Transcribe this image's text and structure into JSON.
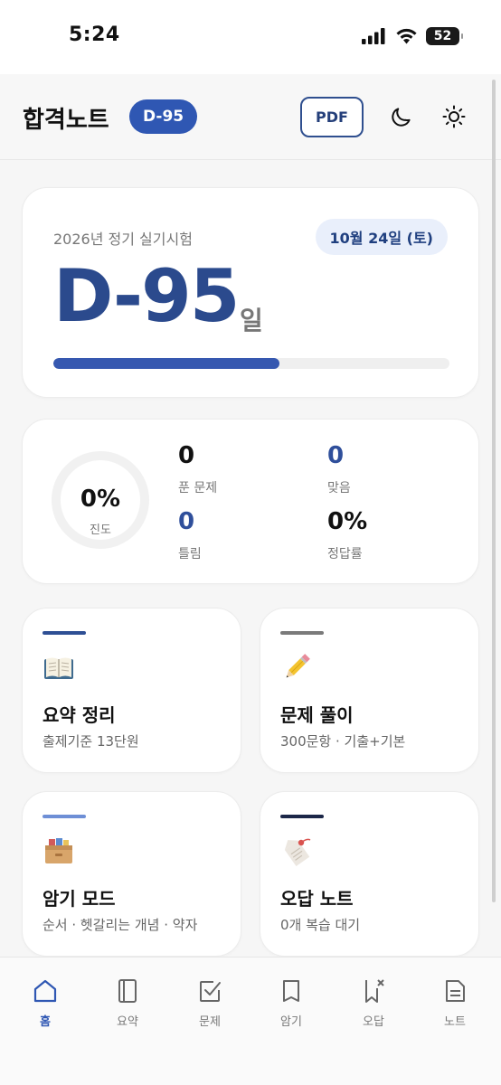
{
  "status_bar": {
    "time": "5:24",
    "battery": "52",
    "icons": [
      "signal-icon",
      "wifi-icon",
      "battery-icon"
    ]
  },
  "header": {
    "title": "합격노트",
    "dday_badge": "D-95",
    "pdf_label": "PDF",
    "icons": [
      "moon-icon",
      "sun-icon"
    ]
  },
  "exam": {
    "name": "2026년 정기 실기시험",
    "date": "10월 24일 (토)",
    "dday": "D-95",
    "unit": "일",
    "progress_fraction": 0.57
  },
  "stats": {
    "progress_value": "0%",
    "progress_label": "진도",
    "solved_value": "0",
    "solved_label": "푼 문제",
    "correct_value": "0",
    "correct_label": "맞음",
    "wrong_value": "0",
    "wrong_label": "틀림",
    "rate_value": "0%",
    "rate_label": "정답률"
  },
  "menu": [
    {
      "title": "요약 정리",
      "subtitle": "출제기준 13단원",
      "icon": "open-book-icon",
      "accent": "#2e4f94"
    },
    {
      "title": "문제 풀이",
      "subtitle": "300문항 · 기출+기본",
      "icon": "pencil-icon",
      "accent": "#7a7a7a"
    },
    {
      "title": "암기 모드",
      "subtitle": "순서 · 헷갈리는 개념 · 약자",
      "icon": "card-box-icon",
      "accent": "#6e8fd6"
    },
    {
      "title": "오답 노트",
      "subtitle": "0개 복습 대기",
      "icon": "tag-icon",
      "accent": "#1c2748"
    }
  ],
  "nav": [
    {
      "label": "홈",
      "icon": "home-icon",
      "active": true
    },
    {
      "label": "요약",
      "icon": "book-icon",
      "active": false
    },
    {
      "label": "문제",
      "icon": "checkbox-icon",
      "active": false
    },
    {
      "label": "암기",
      "icon": "flashcard-icon",
      "active": false
    },
    {
      "label": "오답",
      "icon": "bookmark-x-icon",
      "active": false
    },
    {
      "label": "노트",
      "icon": "note-icon",
      "active": false
    }
  ],
  "colors": {
    "primary": "#2f57b3",
    "primary_dark": "#2b4a8d",
    "date_pill_bg": "#e9effb"
  }
}
